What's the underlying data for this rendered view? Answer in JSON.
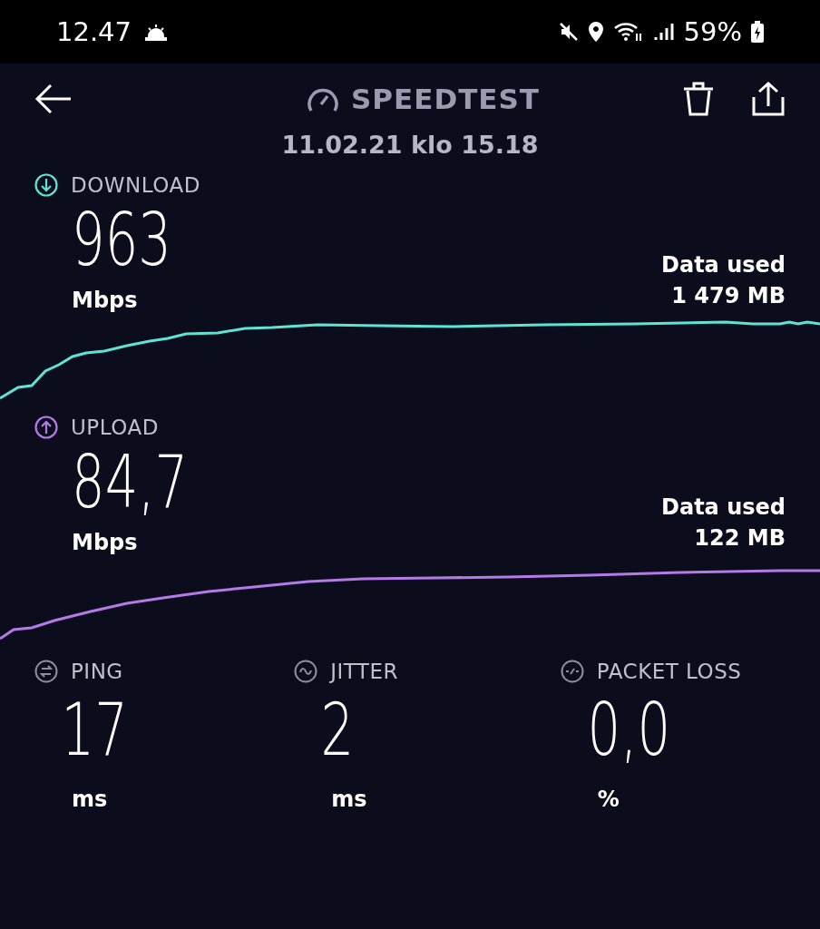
{
  "status_bar": {
    "time": "12.47",
    "battery": "59%"
  },
  "header": {
    "title": "SPEEDTEST",
    "date": "11.02.21 klo 15.18"
  },
  "results": [
    {
      "kind": "download",
      "label": "DOWNLOAD",
      "value": "963",
      "unit": "Mbps",
      "data_label": "Data used",
      "data_value": "1 479 MB",
      "color": "#5fe3d3"
    },
    {
      "kind": "upload",
      "label": "UPLOAD",
      "value": "84,7",
      "unit": "Mbps",
      "data_label": "Data used",
      "data_value": "122 MB",
      "color": "#b67ae8"
    }
  ],
  "metrics": [
    {
      "kind": "ping",
      "label": "PING",
      "value": "17",
      "unit": "ms"
    },
    {
      "kind": "jitter",
      "label": "JITTER",
      "value": "2",
      "unit": "ms"
    },
    {
      "kind": "packet_loss",
      "label": "PACKET LOSS",
      "value": "0,0",
      "unit": "%"
    }
  ]
}
